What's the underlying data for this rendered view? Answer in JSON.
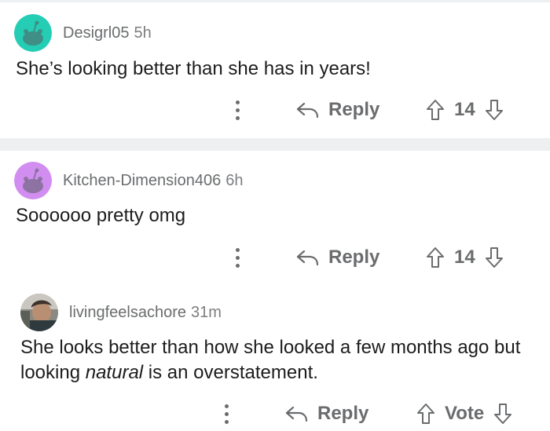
{
  "comments": [
    {
      "username": "Desigrl05",
      "time": "5h",
      "text": "She’s looking better than she has in years!",
      "reply_label": "Reply",
      "vote_label": "14",
      "avatar_color": "#24cdb4"
    },
    {
      "username": "Kitchen-Dimension406",
      "time": "6h",
      "text": "Soooooo pretty omg",
      "reply_label": "Reply",
      "vote_label": "14",
      "avatar_color": "#d18ef0"
    },
    {
      "username": "livingfeelsachore",
      "time": "31m",
      "text_before": "She looks better than how she looked a few months ago but looking ",
      "text_em": "natural",
      "text_after": " is an overstatement.",
      "reply_label": "Reply",
      "vote_label": "Vote"
    }
  ],
  "icons": {
    "more": "more-options-icon",
    "reply": "reply-arrow-icon",
    "upvote": "upvote-arrow-icon",
    "downvote": "downvote-arrow-icon"
  },
  "colors": {
    "separator": "#edeff1",
    "meta_text": "#6a6c6e"
  }
}
